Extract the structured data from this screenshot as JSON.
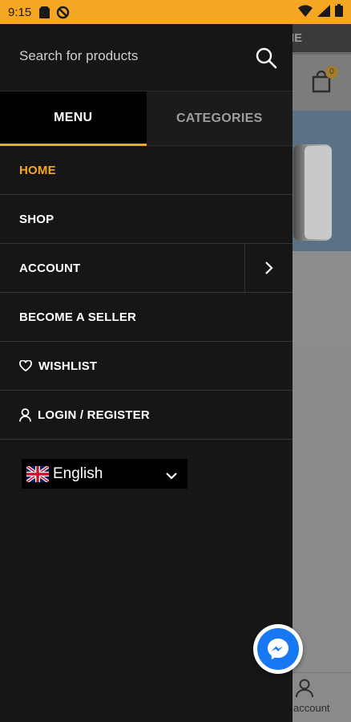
{
  "status_bar": {
    "time": "9:15",
    "left_icons": [
      "sim-card-icon",
      "data-saver-icon"
    ],
    "right_icons": [
      "wifi-icon",
      "signal-icon",
      "battery-icon"
    ],
    "background_color": "#f5a623"
  },
  "drawer": {
    "search": {
      "placeholder": "Search for products",
      "value": ""
    },
    "tabs": [
      {
        "label": "MENU",
        "active": true
      },
      {
        "label": "CATEGORIES",
        "active": false
      }
    ],
    "menu_items": [
      {
        "label": "HOME",
        "active": true,
        "icon": null,
        "expandable": false
      },
      {
        "label": "SHOP",
        "active": false,
        "icon": null,
        "expandable": false
      },
      {
        "label": "ACCOUNT",
        "active": false,
        "icon": null,
        "expandable": true
      },
      {
        "label": "BECOME A SELLER",
        "active": false,
        "icon": null,
        "expandable": false
      },
      {
        "label": "WISHLIST",
        "active": false,
        "icon": "heart-icon",
        "expandable": false
      },
      {
        "label": "LOGIN / REGISTER",
        "active": false,
        "icon": "user-icon",
        "expandable": false
      }
    ],
    "language": {
      "selected": "English",
      "flag": "uk-flag-icon"
    },
    "accent_color": "#f5a623"
  },
  "background_page": {
    "top_strip_text": "IE",
    "cart_badge": "0",
    "bottom_nav_account_label": "account"
  },
  "floating": {
    "messenger_icon": "messenger-icon"
  }
}
